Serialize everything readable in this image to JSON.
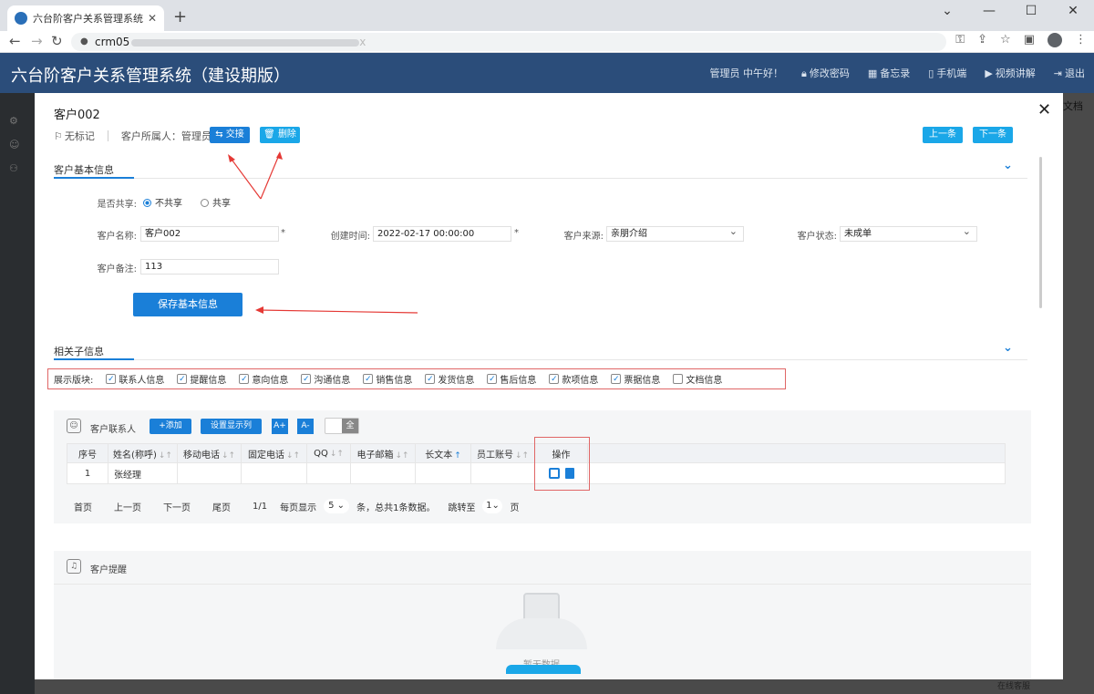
{
  "browser": {
    "tab_title": "六台阶客户关系管理系统（建设期",
    "url": "crm05",
    "url_suffix": "x",
    "window_controls": [
      "⌄",
      "—",
      "☐",
      "✕"
    ]
  },
  "app": {
    "title": "六台阶客户关系管理系统（建设期版）",
    "greeting": "管理员 中午好！",
    "tools": [
      "修改密码",
      "备忘录",
      "手机端",
      "视频讲解",
      "退出"
    ],
    "right_doc": "文档",
    "online_service": "在线客服"
  },
  "customer": {
    "name": "客户002",
    "flag": "无标记",
    "owner_label": "客户所属人：",
    "owner": "管理员",
    "swap_label": "交接",
    "delete_label": "删除",
    "prev_label": "上一条",
    "next_label": "下一条"
  },
  "basic_info": {
    "section_title": "客户基本信息",
    "share_label": "是否共享:",
    "share_options": [
      "不共享",
      "共享"
    ],
    "share_selected": "不共享",
    "name_label": "客户名称:",
    "name_value": "客户002",
    "created_label": "创建时间:",
    "created_value": "2022-02-17 00:00:00",
    "source_label": "客户来源:",
    "source_value": "亲朋介绍",
    "status_label": "客户状态:",
    "status_value": "未成单",
    "note_label": "客户备注:",
    "note_value": "113",
    "required_mark": "*",
    "save_label": "保存基本信息"
  },
  "related": {
    "section_title": "相关子信息",
    "show_label": "展示版块:",
    "blocks": [
      {
        "label": "联系人信息",
        "checked": true
      },
      {
        "label": "提醒信息",
        "checked": true
      },
      {
        "label": "意向信息",
        "checked": true
      },
      {
        "label": "沟通信息",
        "checked": true
      },
      {
        "label": "销售信息",
        "checked": true
      },
      {
        "label": "发货信息",
        "checked": true
      },
      {
        "label": "售后信息",
        "checked": true
      },
      {
        "label": "款项信息",
        "checked": true
      },
      {
        "label": "票据信息",
        "checked": true
      },
      {
        "label": "文档信息",
        "checked": false
      }
    ]
  },
  "contacts": {
    "panel_title": "客户联系人",
    "add_label": "+添加",
    "columns_label": "设置显示列",
    "font_up": "A+",
    "font_down": "A-",
    "toggle_label": "全",
    "headers": [
      "序号",
      "姓名(称呼)",
      "移动电话",
      "固定电话",
      "QQ",
      "电子邮箱",
      "长文本",
      "员工账号",
      "操作"
    ],
    "rows": [
      [
        "1",
        "张经理",
        "",
        "",
        "",
        "",
        "",
        "",
        ""
      ]
    ],
    "pager": {
      "first": "首页",
      "prev": "上一页",
      "next": "下一页",
      "last": "尾页",
      "page_info": "1/1",
      "per_page_label": "每页显示",
      "per_page": "5",
      "total_text": "条，总共1条数据。",
      "goto_label": "跳转至",
      "goto_page": "1",
      "page_suffix": "页"
    }
  },
  "reminders": {
    "panel_title": "客户提醒",
    "empty_text": "暂无数据"
  },
  "colors": {
    "header_bg": "#2b4d7a",
    "primary": "#1a7fd8",
    "accent": "#1aa7e8",
    "highlight": "#e06666"
  }
}
